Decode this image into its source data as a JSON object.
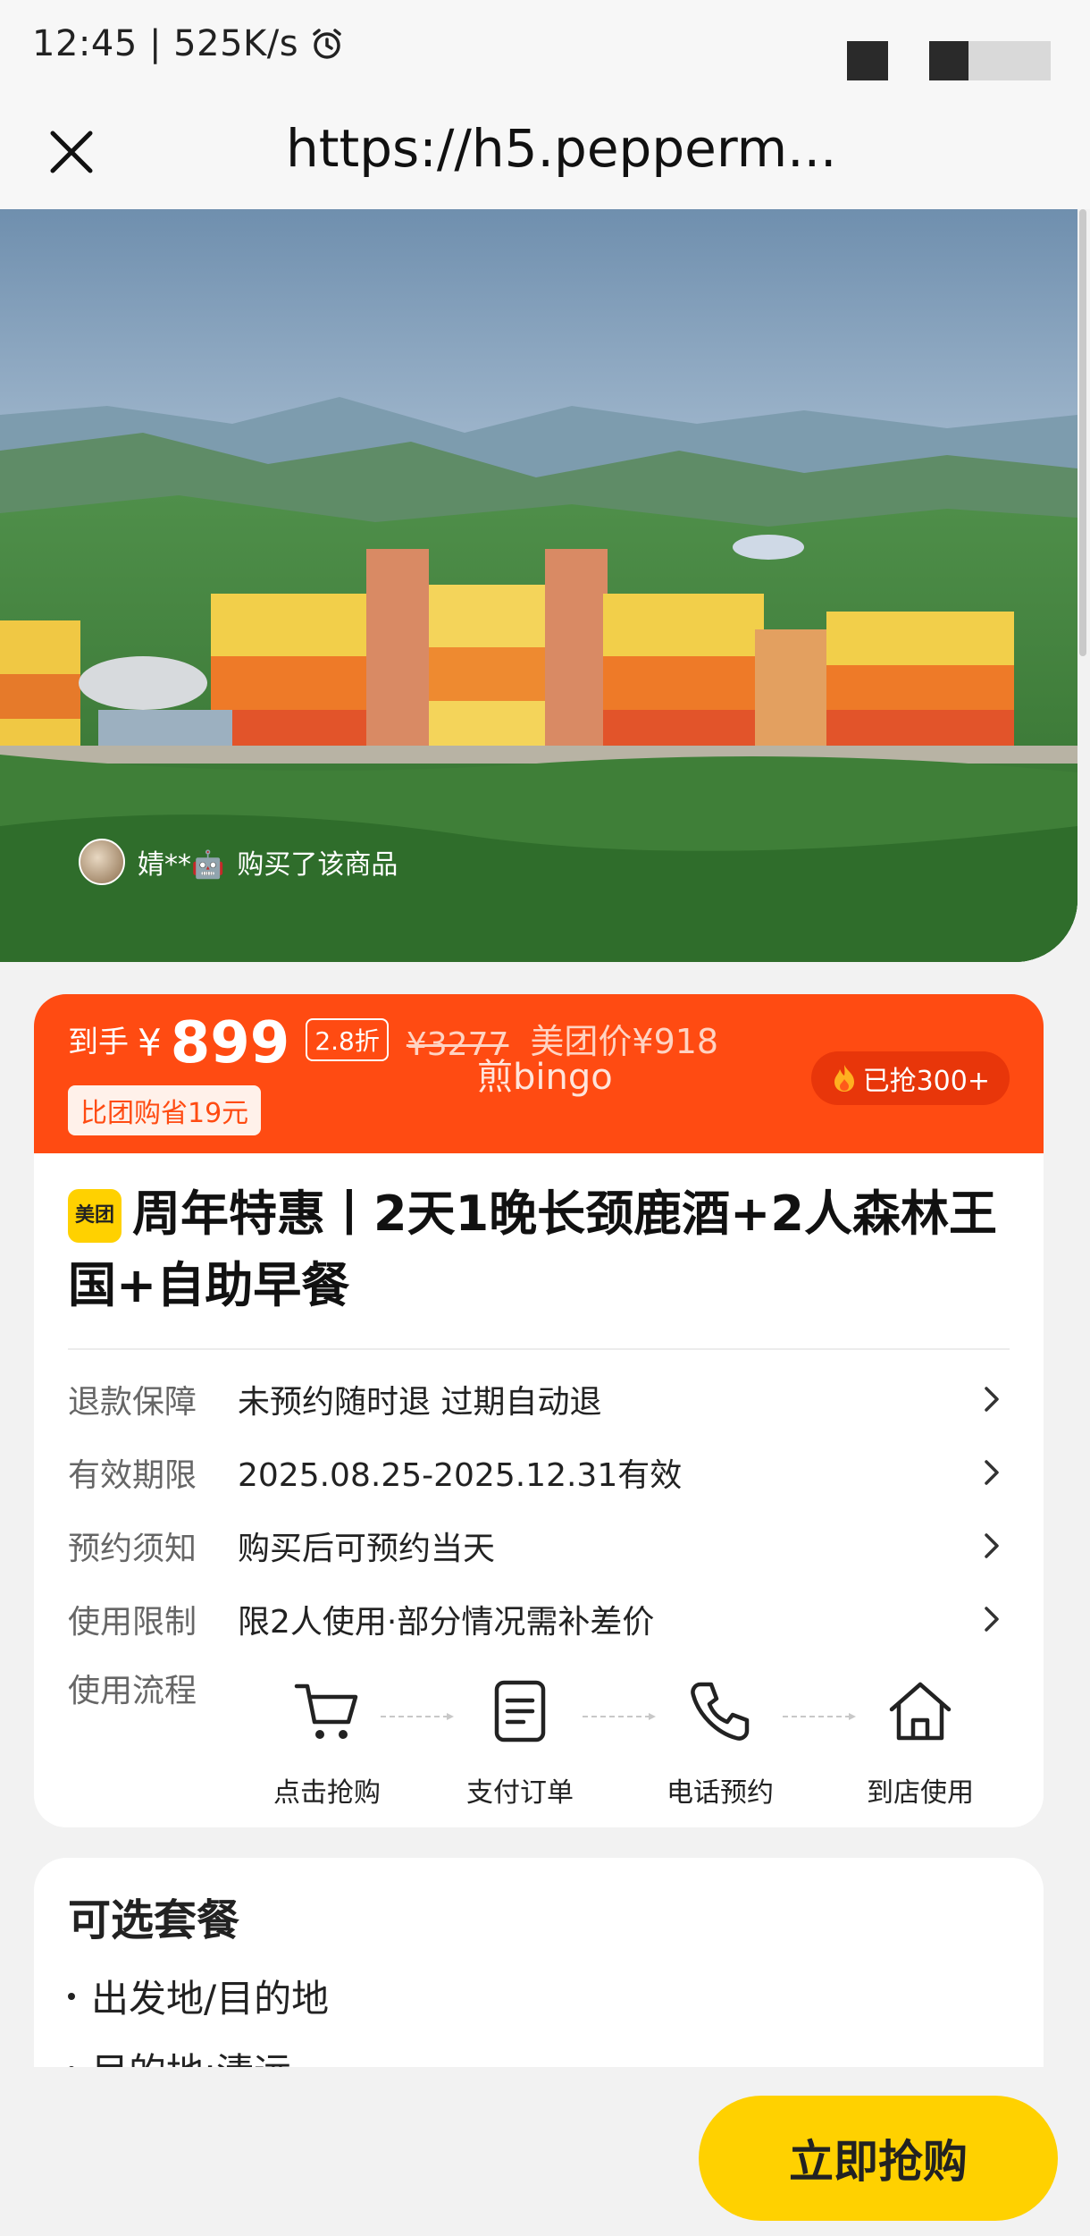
{
  "status_bar": {
    "time_speed": "12:45 | 525K/s"
  },
  "url_bar": {
    "url": "https://h5.pepperm..."
  },
  "hero": {
    "buyer_name": "婧**🤖",
    "buyer_action": "购买了该商品"
  },
  "price": {
    "final_label": "到手",
    "currency": "¥",
    "final_price": "899",
    "discount": "2.8折",
    "original_price": "¥3277",
    "meituan_price": "美团价¥918",
    "watermark": "煎bingo",
    "save_tag": "比团购省19元",
    "sold": "已抢300+",
    "brand_color": "#ff4b12"
  },
  "product": {
    "logo_text": "美团",
    "title": "周年特惠丨2天1晚长颈鹿酒+2人森林王国+自助早餐"
  },
  "details": [
    {
      "label": "退款保障",
      "value": "未预约随时退 过期自动退"
    },
    {
      "label": "有效期限",
      "value": "2025.08.25-2025.12.31有效"
    },
    {
      "label": "预约须知",
      "value": "购买后可预约当天"
    },
    {
      "label": "使用限制",
      "value": "限2人使用·部分情况需补差价"
    }
  ],
  "flow": {
    "label": "使用流程",
    "steps": [
      {
        "label": "点击抢购",
        "icon": "cart-icon"
      },
      {
        "label": "支付订单",
        "icon": "document-icon"
      },
      {
        "label": "电话预约",
        "icon": "phone-icon"
      },
      {
        "label": "到店使用",
        "icon": "house-icon"
      }
    ]
  },
  "options": {
    "title": "可选套餐",
    "items": [
      "出发地/目的地",
      "目的地:清远"
    ]
  },
  "bottom": {
    "buy_label": "立即抢购",
    "button_color": "#ffd100"
  }
}
